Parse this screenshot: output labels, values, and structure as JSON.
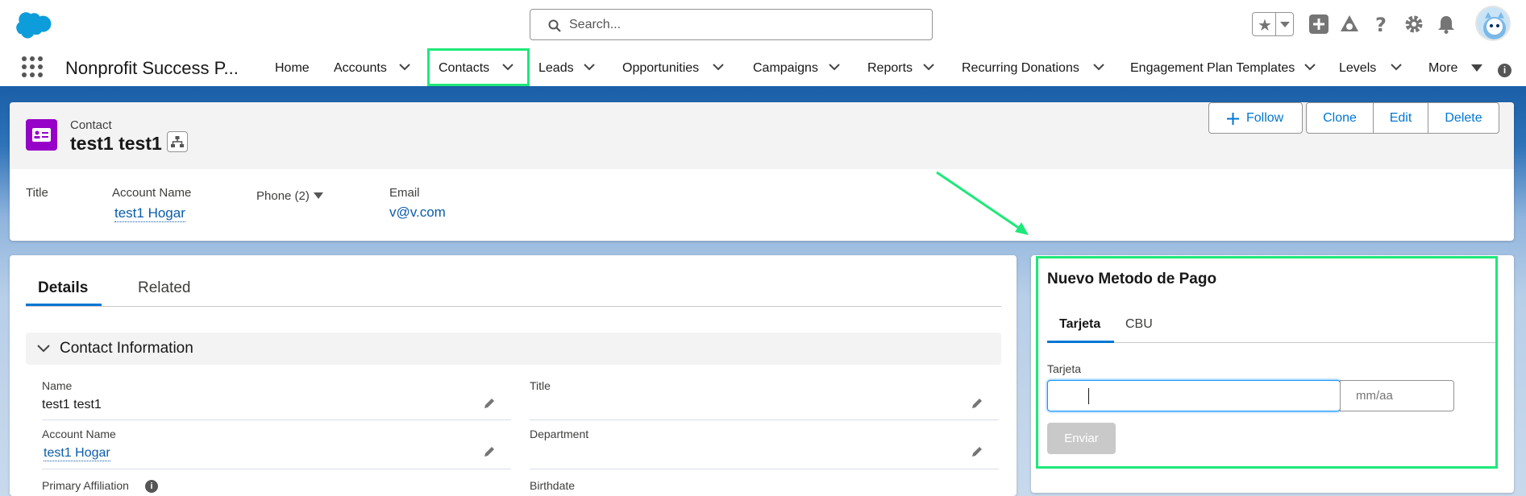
{
  "search": {
    "placeholder": "Search..."
  },
  "nav": {
    "app_name": "Nonprofit Success P...",
    "items": [
      {
        "label": "Home"
      },
      {
        "label": "Accounts"
      },
      {
        "label": "Contacts"
      },
      {
        "label": "Leads"
      },
      {
        "label": "Opportunities"
      },
      {
        "label": "Campaigns"
      },
      {
        "label": "Reports"
      },
      {
        "label": "Recurring Donations"
      },
      {
        "label": "Engagement Plan Templates"
      },
      {
        "label": "Levels"
      },
      {
        "label": "More"
      }
    ],
    "active_item": "Contacts"
  },
  "record": {
    "object_label": "Contact",
    "name": "test1 test1",
    "actions": {
      "follow": "Follow",
      "clone": "Clone",
      "edit": "Edit",
      "delete": "Delete"
    },
    "highlights": {
      "title_label": "Title",
      "account_label": "Account Name",
      "account_value": "test1 Hogar",
      "phone_label": "Phone (2)",
      "email_label": "Email",
      "email_value": "v@v.com"
    }
  },
  "details": {
    "tabs": [
      "Details",
      "Related"
    ],
    "section_title": "Contact Information",
    "fields": {
      "name_label": "Name",
      "name_value": "test1 test1",
      "title_label": "Title",
      "account_label": "Account Name",
      "account_value": "test1 Hogar",
      "department_label": "Department",
      "primary_affiliation_label": "Primary Affiliation",
      "birthdate_label": "Birthdate"
    }
  },
  "payment": {
    "title": "Nuevo Metodo de Pago",
    "tabs": [
      "Tarjeta",
      "CBU"
    ],
    "field_label": "Tarjeta",
    "card_value": "",
    "date_placeholder": "mm/aa",
    "submit_label": "Enviar"
  },
  "colors": {
    "accent": "#0176d3",
    "highlight": "#1ee87a",
    "contact_icon": "#9602c7",
    "header_band": "#1b5fa8"
  }
}
